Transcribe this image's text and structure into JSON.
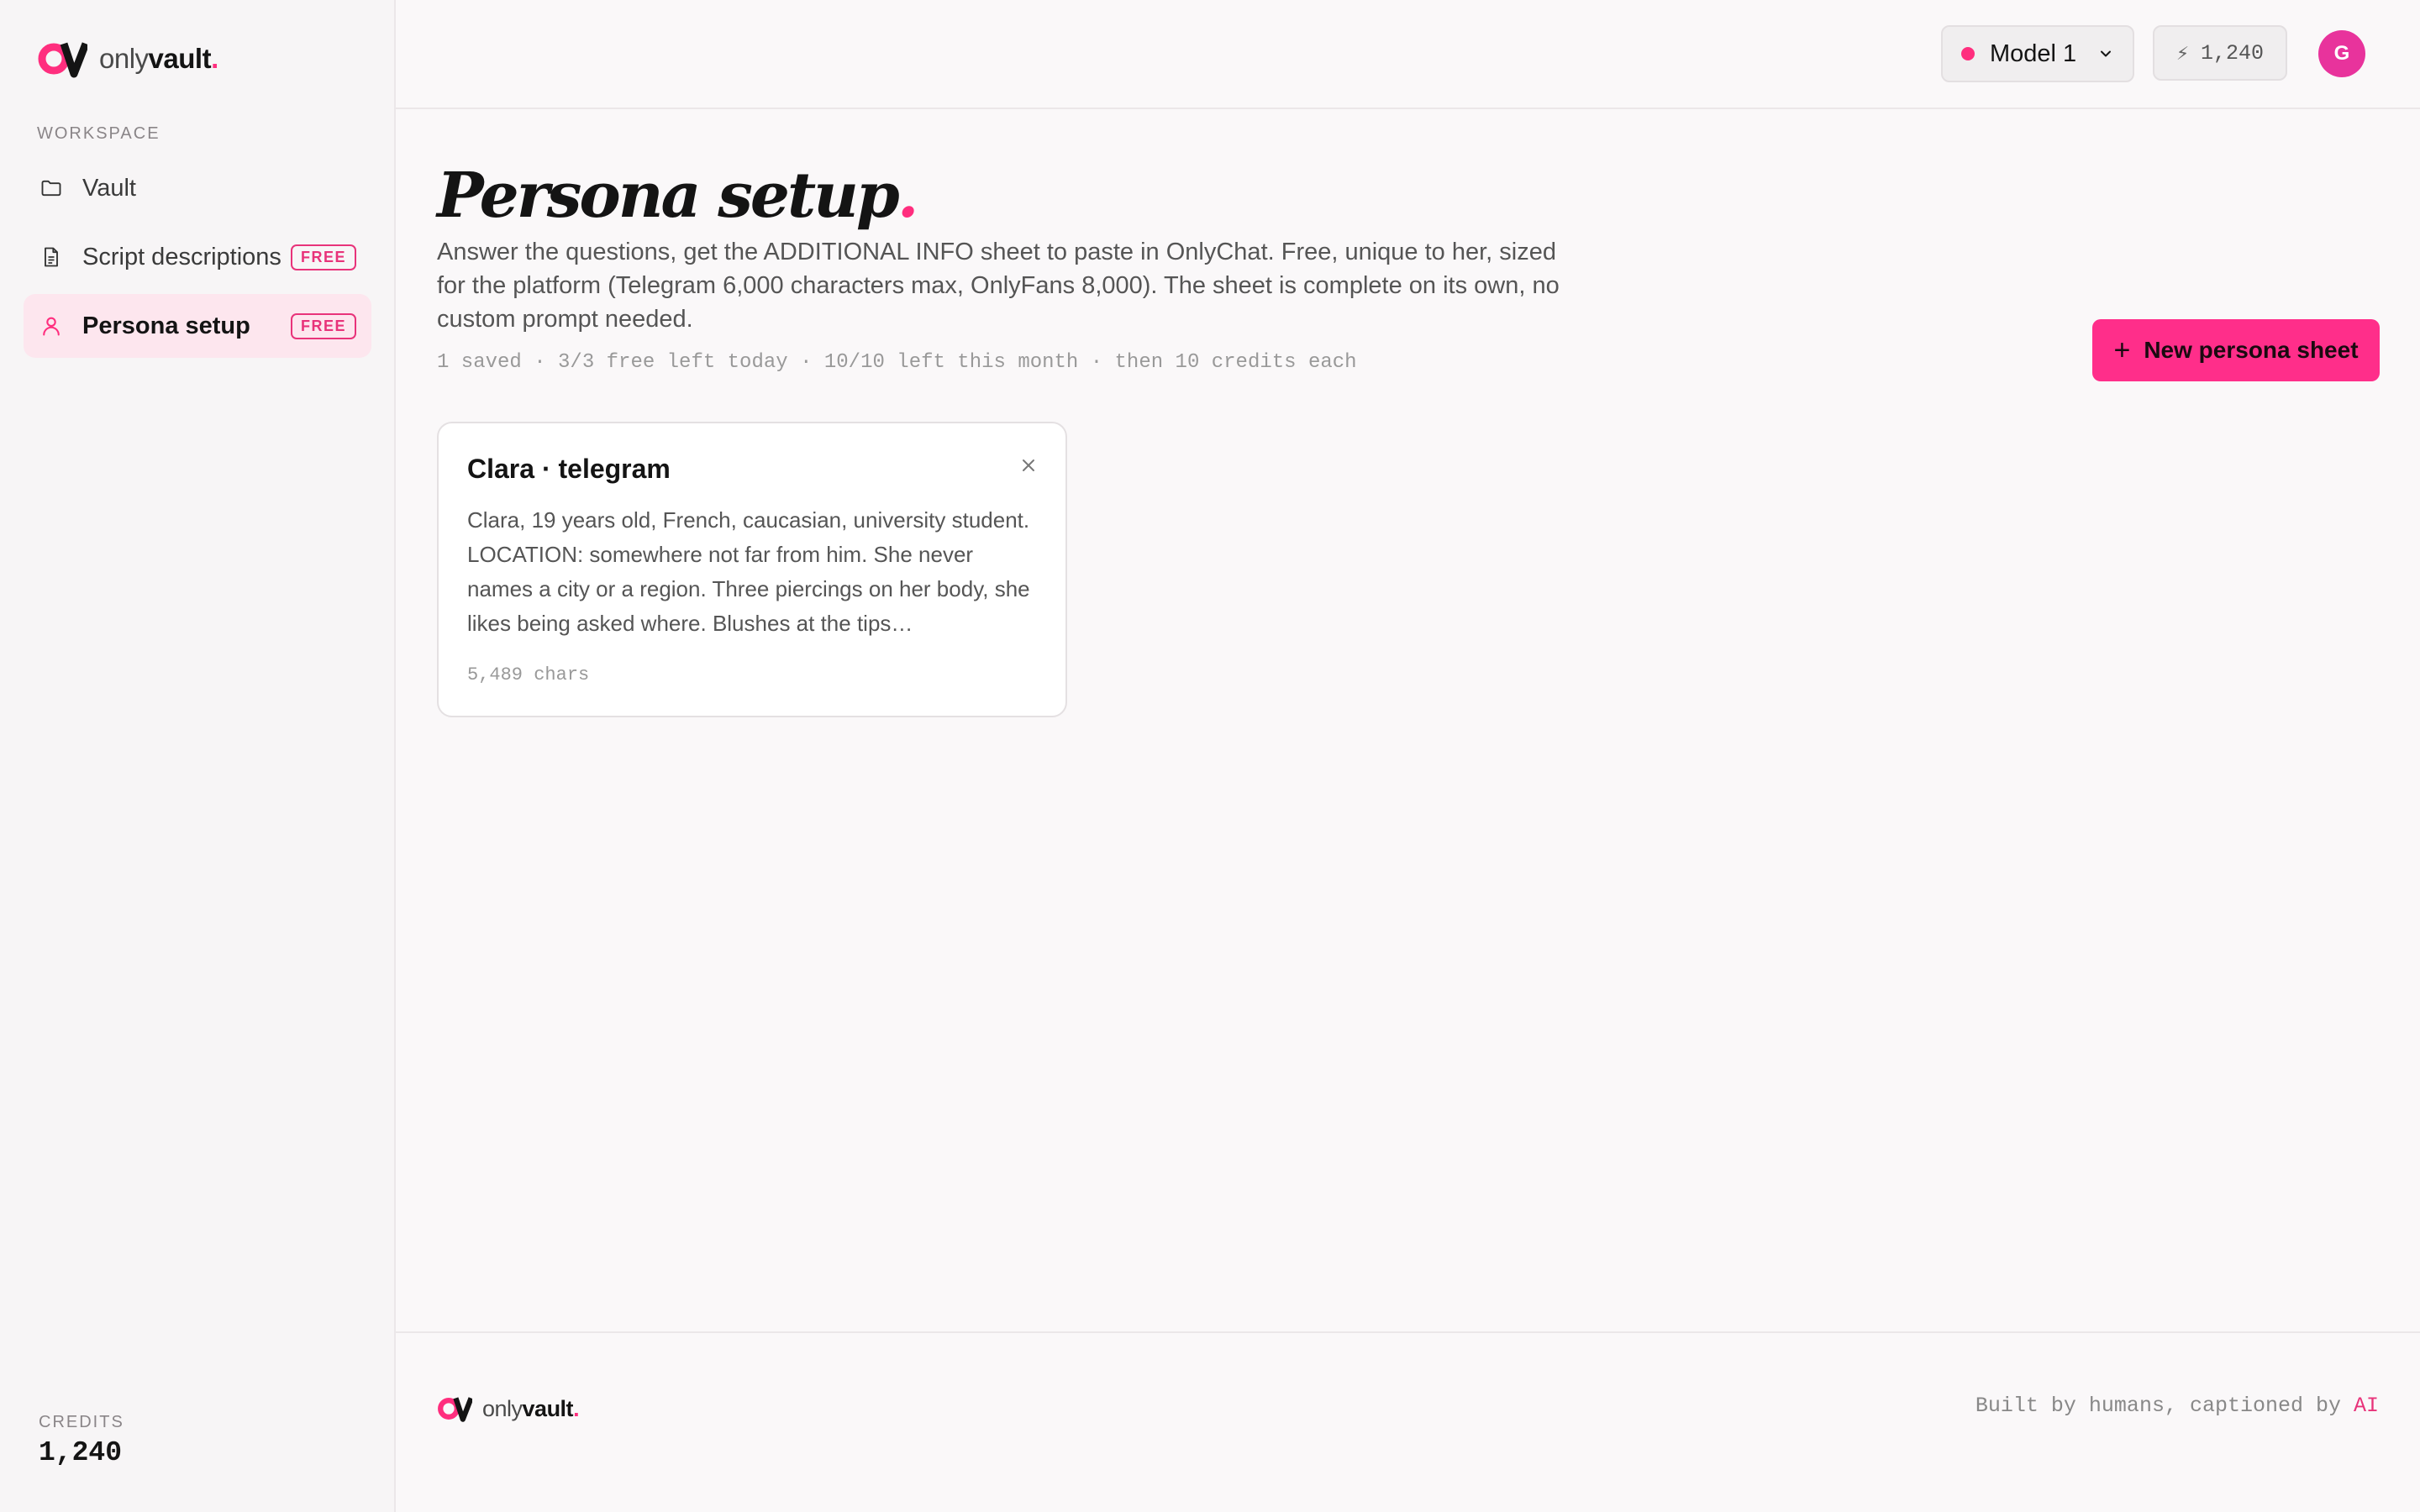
{
  "brand": {
    "prefix": "only",
    "bold": "vault",
    "dot": "."
  },
  "sidebar": {
    "section_label": "WORKSPACE",
    "items": [
      {
        "label": "Vault",
        "icon": "folder-icon",
        "badge": ""
      },
      {
        "label": "Script descriptions",
        "icon": "document-icon",
        "badge": "FREE"
      },
      {
        "label": "Persona setup",
        "icon": "person-icon",
        "badge": "FREE"
      }
    ],
    "credits_label": "CREDITS",
    "credits_value": "1,240"
  },
  "topbar": {
    "model_label": "Model 1",
    "credits": "1,240",
    "avatar_initial": "G"
  },
  "main": {
    "title": "Persona setup",
    "title_dot": ".",
    "description": "Answer the questions, get the ADDITIONAL INFO sheet to paste in OnlyChat. Free, unique to her, sized for the platform (Telegram 6,000 characters max, OnlyFans 8,000). The sheet is complete on its own, no custom prompt needed.",
    "meta": "1 saved · 3/3 free left today · 10/10 left this month · then 10 credits each",
    "new_button": "New persona sheet"
  },
  "cards": [
    {
      "title": "Clara · telegram",
      "body": "Clara, 19 years old, French, caucasian, university student. LOCATION: somewhere not far from him. She never names a city or a region. Three piercings on her body, she likes being asked where. Blushes at the tips…",
      "chars": "5,489 chars"
    }
  ],
  "footer": {
    "tagline": "Built by humans, captioned by ",
    "tagline_accent": "AI"
  },
  "colors": {
    "accent": "#ff2e7e",
    "active_bg": "#fde6ee",
    "avatar": "#e8339c"
  }
}
